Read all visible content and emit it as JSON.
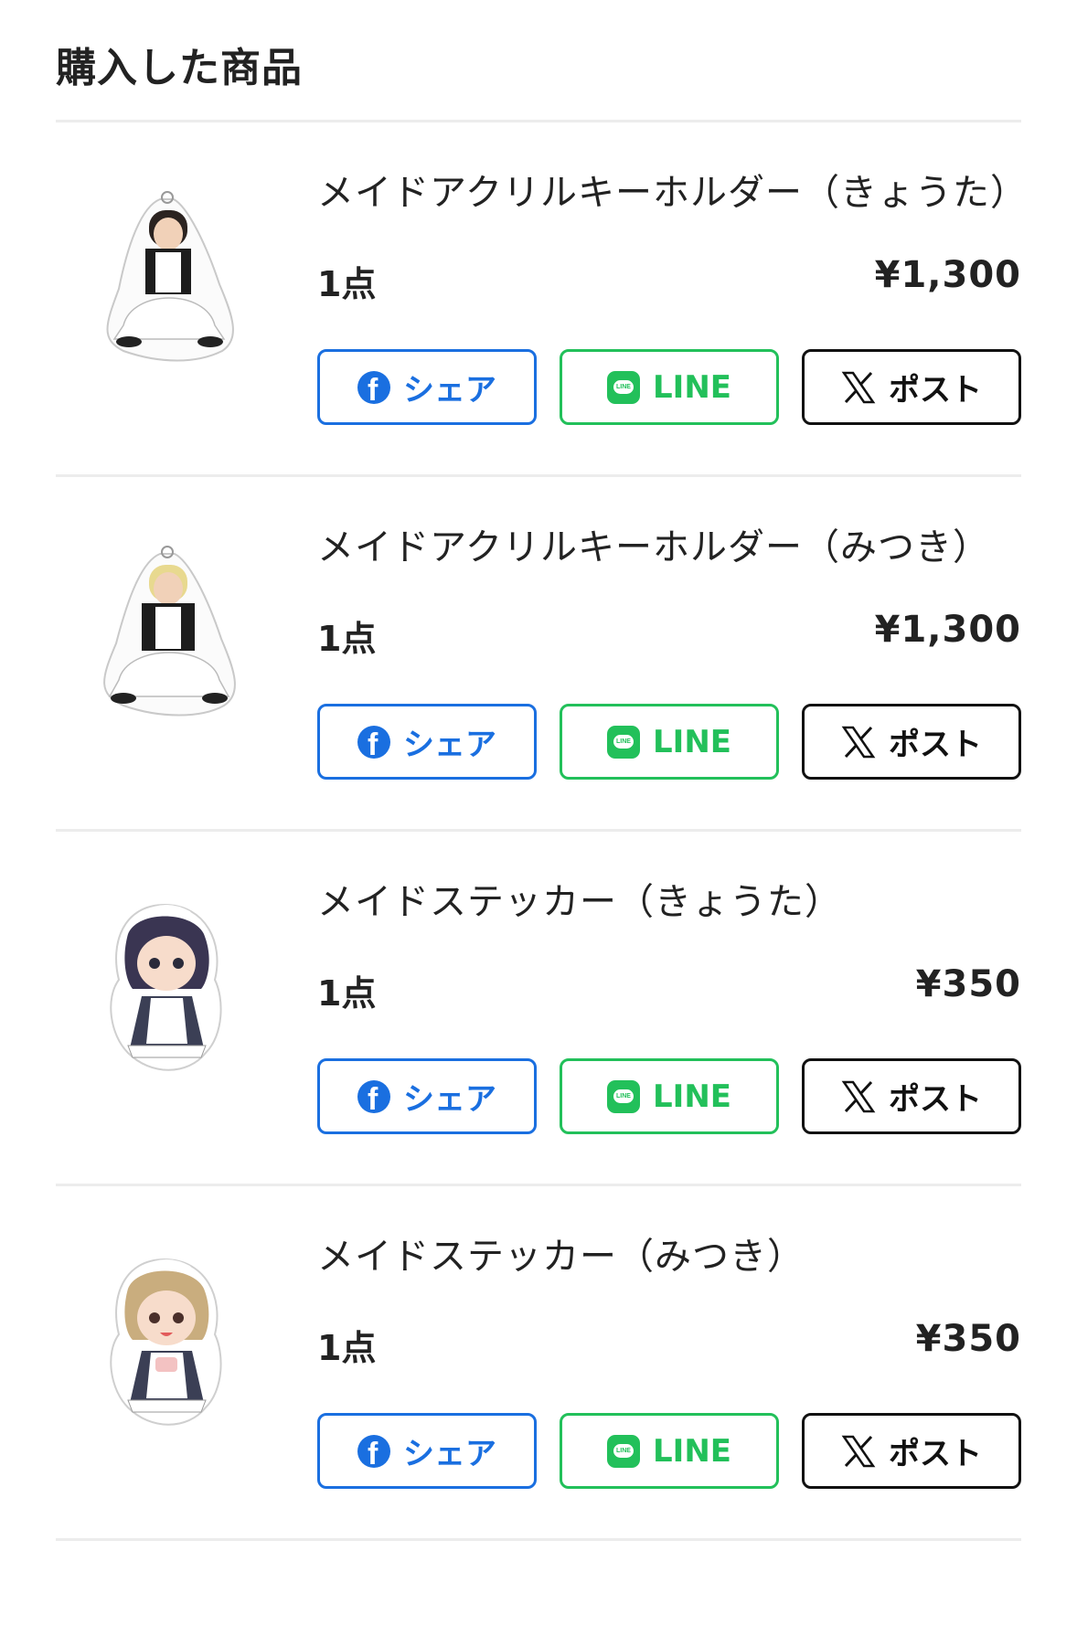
{
  "page": {
    "title": "購入した商品"
  },
  "items": [
    {
      "name": "メイドアクリルキーホルダー（きょうた）",
      "quantity": "1点",
      "price": "¥1,300",
      "share": {
        "facebook": "シェア",
        "line": "LINE",
        "x": "ポスト"
      }
    },
    {
      "name": "メイドアクリルキーホルダー（みつき）",
      "quantity": "1点",
      "price": "¥1,300",
      "share": {
        "facebook": "シェア",
        "line": "LINE",
        "x": "ポスト"
      }
    },
    {
      "name": "メイドステッカー（きょうた）",
      "quantity": "1点",
      "price": "¥350",
      "share": {
        "facebook": "シェア",
        "line": "LINE",
        "x": "ポスト"
      }
    },
    {
      "name": "メイドステッカー（みつき）",
      "quantity": "1点",
      "price": "¥350",
      "share": {
        "facebook": "シェア",
        "line": "LINE",
        "x": "ポスト"
      }
    }
  ],
  "icons": {
    "facebook": "facebook-icon",
    "line": "line-icon",
    "line_badge_text": "LINE",
    "x": "x-logo-icon"
  },
  "colors": {
    "facebook": "#1a6fe0",
    "line": "#22c05a",
    "x": "#111111",
    "divider": "#ececec"
  }
}
